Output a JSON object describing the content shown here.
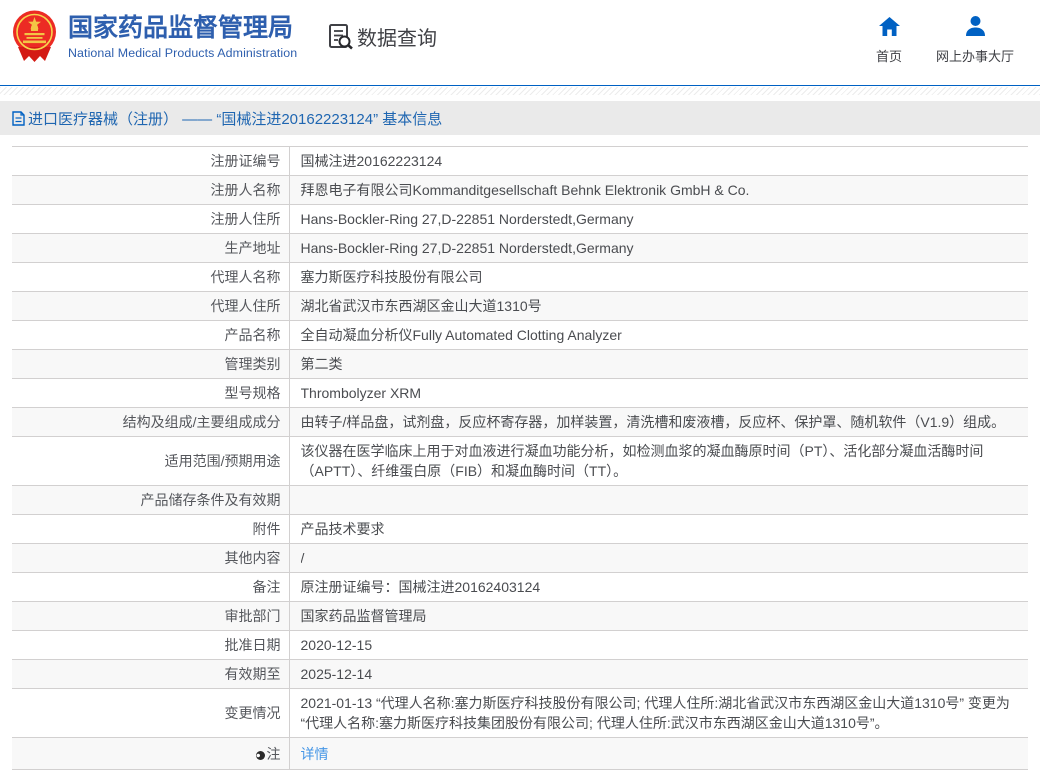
{
  "header": {
    "title": "国家药品监督管理局",
    "subtitle": "National Medical Products Administration",
    "data_query_label": "数据查询",
    "nav": {
      "home": "首页",
      "hall": "网上办事大厅"
    }
  },
  "colors": {
    "primary_blue": "#0061c3",
    "brand_blue": "#2e5fae",
    "crumb_bg": "#eaeaea",
    "row_alt": "#f8f8f8",
    "link_blue": "#4596e6"
  },
  "breadcrumb": {
    "text": "进口医疗器械（注册） —— “国械注进20162223124” 基本信息"
  },
  "table": {
    "rows": [
      {
        "label": "注册证编号",
        "value": "国械注进20162223124"
      },
      {
        "label": "注册人名称",
        "value": "拜恩电子有限公司Kommanditgesellschaft Behnk Elektronik GmbH & Co."
      },
      {
        "label": "注册人住所",
        "value": "Hans-Bockler-Ring 27,D-22851 Norderstedt,Germany"
      },
      {
        "label": "生产地址",
        "value": "Hans-Bockler-Ring 27,D-22851 Norderstedt,Germany"
      },
      {
        "label": "代理人名称",
        "value": "塞力斯医疗科技股份有限公司"
      },
      {
        "label": "代理人住所",
        "value": "湖北省武汉市东西湖区金山大道1310号"
      },
      {
        "label": "产品名称",
        "value": "全自动凝血分析仪Fully Automated Clotting Analyzer"
      },
      {
        "label": "管理类别",
        "value": "第二类"
      },
      {
        "label": "型号规格",
        "value": "Thrombolyzer XRM"
      },
      {
        "label": "结构及组成/主要组成成分",
        "value": "由转子/样品盘，试剂盘，反应杯寄存器，加样装置，清洗槽和废液槽，反应杯、保护罩、随机软件（V1.9）组成。"
      },
      {
        "label": "适用范围/预期用途",
        "value": "该仪器在医学临床上用于对血液进行凝血功能分析，如检测血浆的凝血酶原时间（PT）、活化部分凝血活酶时间（APTT）、纤维蛋白原（FIB）和凝血酶时间（TT）。",
        "tall": true
      },
      {
        "label": "产品储存条件及有效期",
        "value": ""
      },
      {
        "label": "附件",
        "value": "产品技术要求"
      },
      {
        "label": "其他内容",
        "value": "/"
      },
      {
        "label": "备注",
        "value": "原注册证编号：国械注进20162403124"
      },
      {
        "label": "审批部门",
        "value": "国家药品监督管理局"
      },
      {
        "label": "批准日期",
        "value": "2020-12-15"
      },
      {
        "label": "有效期至",
        "value": "2025-12-14"
      },
      {
        "label": "变更情况",
        "value": "2021-01-13 “代理人名称:塞力斯医疗科技股份有限公司; 代理人住所:湖北省武汉市东西湖区金山大道1310号” 变更为 “代理人名称:塞力斯医疗科技集团股份有限公司; 代理人住所:武汉市东西湖区金山大道1310号”。",
        "tall": true
      },
      {
        "label": "注",
        "icon": "note-dot",
        "value": "详情",
        "link": true
      }
    ]
  }
}
